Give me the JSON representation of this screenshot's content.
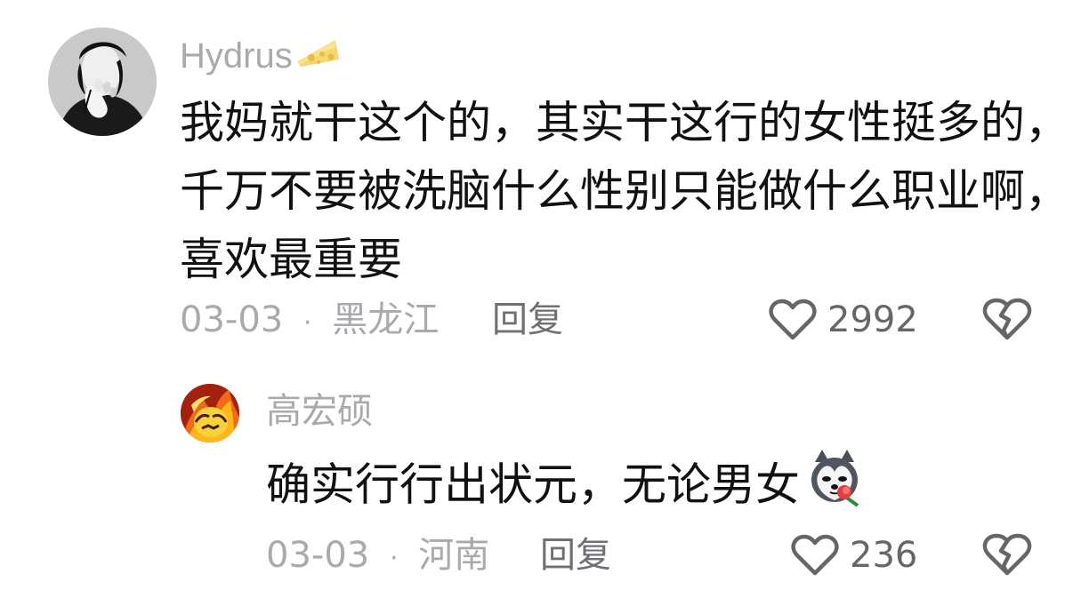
{
  "comments": [
    {
      "username": "Hydrus",
      "badge_icon": "cheese-icon",
      "text": "我妈就干这个的，其实干这行的女性挺多的，千万不要被洗脑什么性别只能做什么职业啊，喜欢最重要",
      "date": "03-03",
      "separator": "·",
      "location": "黑龙江",
      "reply_label": "回复",
      "likes": "2992"
    },
    {
      "username": "高宏硕",
      "text": "确实行行出状元，无论男女",
      "emoji_icon": "husky-rose-emoji-icon",
      "date": "03-03",
      "separator": "·",
      "location": "河南",
      "reply_label": "回复",
      "likes": "236"
    }
  ],
  "colors": {
    "text": "#111111",
    "muted": "#a9a9ae",
    "reply": "#6f6f74"
  }
}
